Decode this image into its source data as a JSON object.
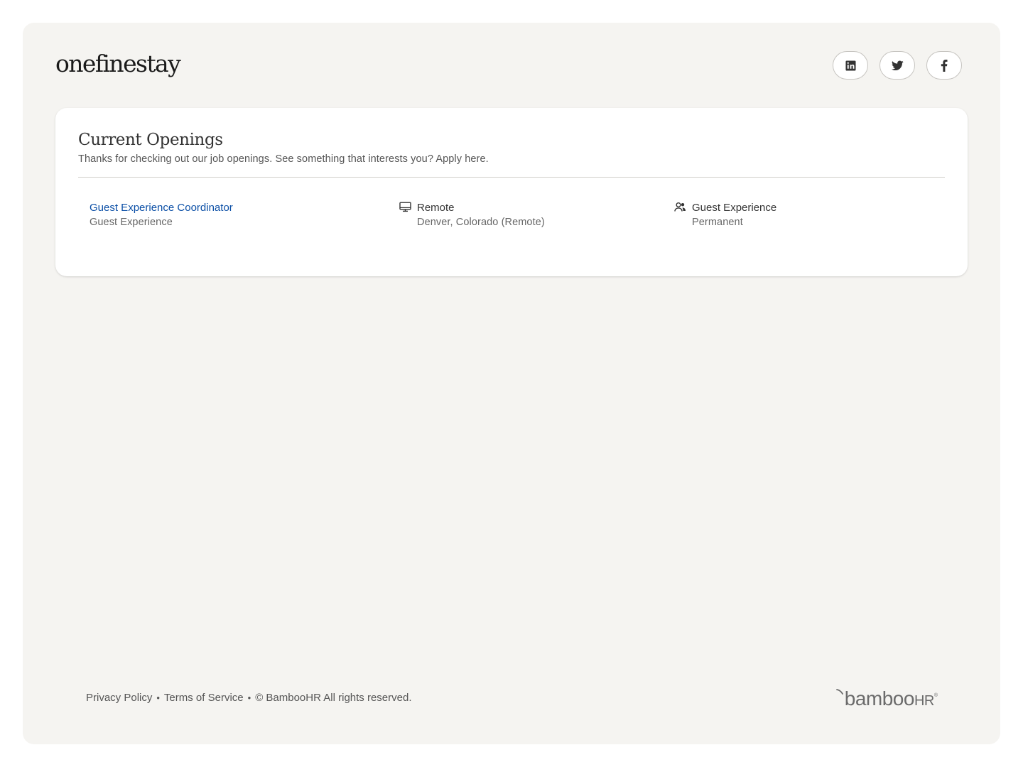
{
  "brand": {
    "logo_text": "onefinestay"
  },
  "social": [
    {
      "name": "LinkedIn",
      "icon": "linkedin-icon"
    },
    {
      "name": "Twitter",
      "icon": "twitter-icon"
    },
    {
      "name": "Facebook",
      "icon": "facebook-icon"
    }
  ],
  "openings": {
    "title": "Current Openings",
    "subtitle": "Thanks for checking out our job openings. See something that interests you? Apply here.",
    "jobs": [
      {
        "title": "Guest Experience Coordinator",
        "department": "Guest Experience",
        "location_type": "Remote",
        "location": "Denver, Colorado (Remote)",
        "team": "Guest Experience",
        "employment_type": "Permanent"
      }
    ]
  },
  "footer": {
    "privacy": "Privacy Policy",
    "terms": "Terms of Service",
    "copyright": "© BambooHR All rights reserved.",
    "bamboo_logo_main": "bamboo",
    "bamboo_logo_hr": "HR",
    "bamboo_logo_tm": "®"
  },
  "colors": {
    "page_background": "#f5f4f1",
    "card_background": "#ffffff",
    "link": "#0b4fa6",
    "text_primary": "#333333",
    "text_secondary": "#666666"
  }
}
